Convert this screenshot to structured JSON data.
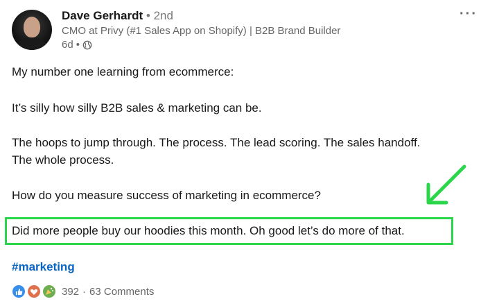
{
  "author": {
    "name": "Dave Gerhardt",
    "degree": "• 2nd",
    "headline": "CMO at Privy (#1 Sales App on Shopify) | B2B Brand Builder",
    "time": "6d",
    "visibility_sep": "•"
  },
  "post": {
    "line1": "My number one learning from ecommerce:",
    "line2": "It’s silly how silly B2B sales & marketing can be.",
    "line3": "The hoops to jump through. The process. The lead scoring. The sales handoff.",
    "line4": "The whole process.",
    "line5": "How do you measure success of marketing in ecommerce?",
    "line6": "Did more people buy our hoodies this month. Oh good let’s do more of that.",
    "hashtag": "#marketing"
  },
  "social": {
    "reactions": "392",
    "separator": "·",
    "comments": "63 Comments"
  },
  "colors": {
    "highlight": "#2bd64b",
    "link": "#0a66c2"
  },
  "icons": [
    "more-icon",
    "globe-icon",
    "like-icon",
    "love-icon",
    "celebrate-icon",
    "arrow-icon"
  ]
}
